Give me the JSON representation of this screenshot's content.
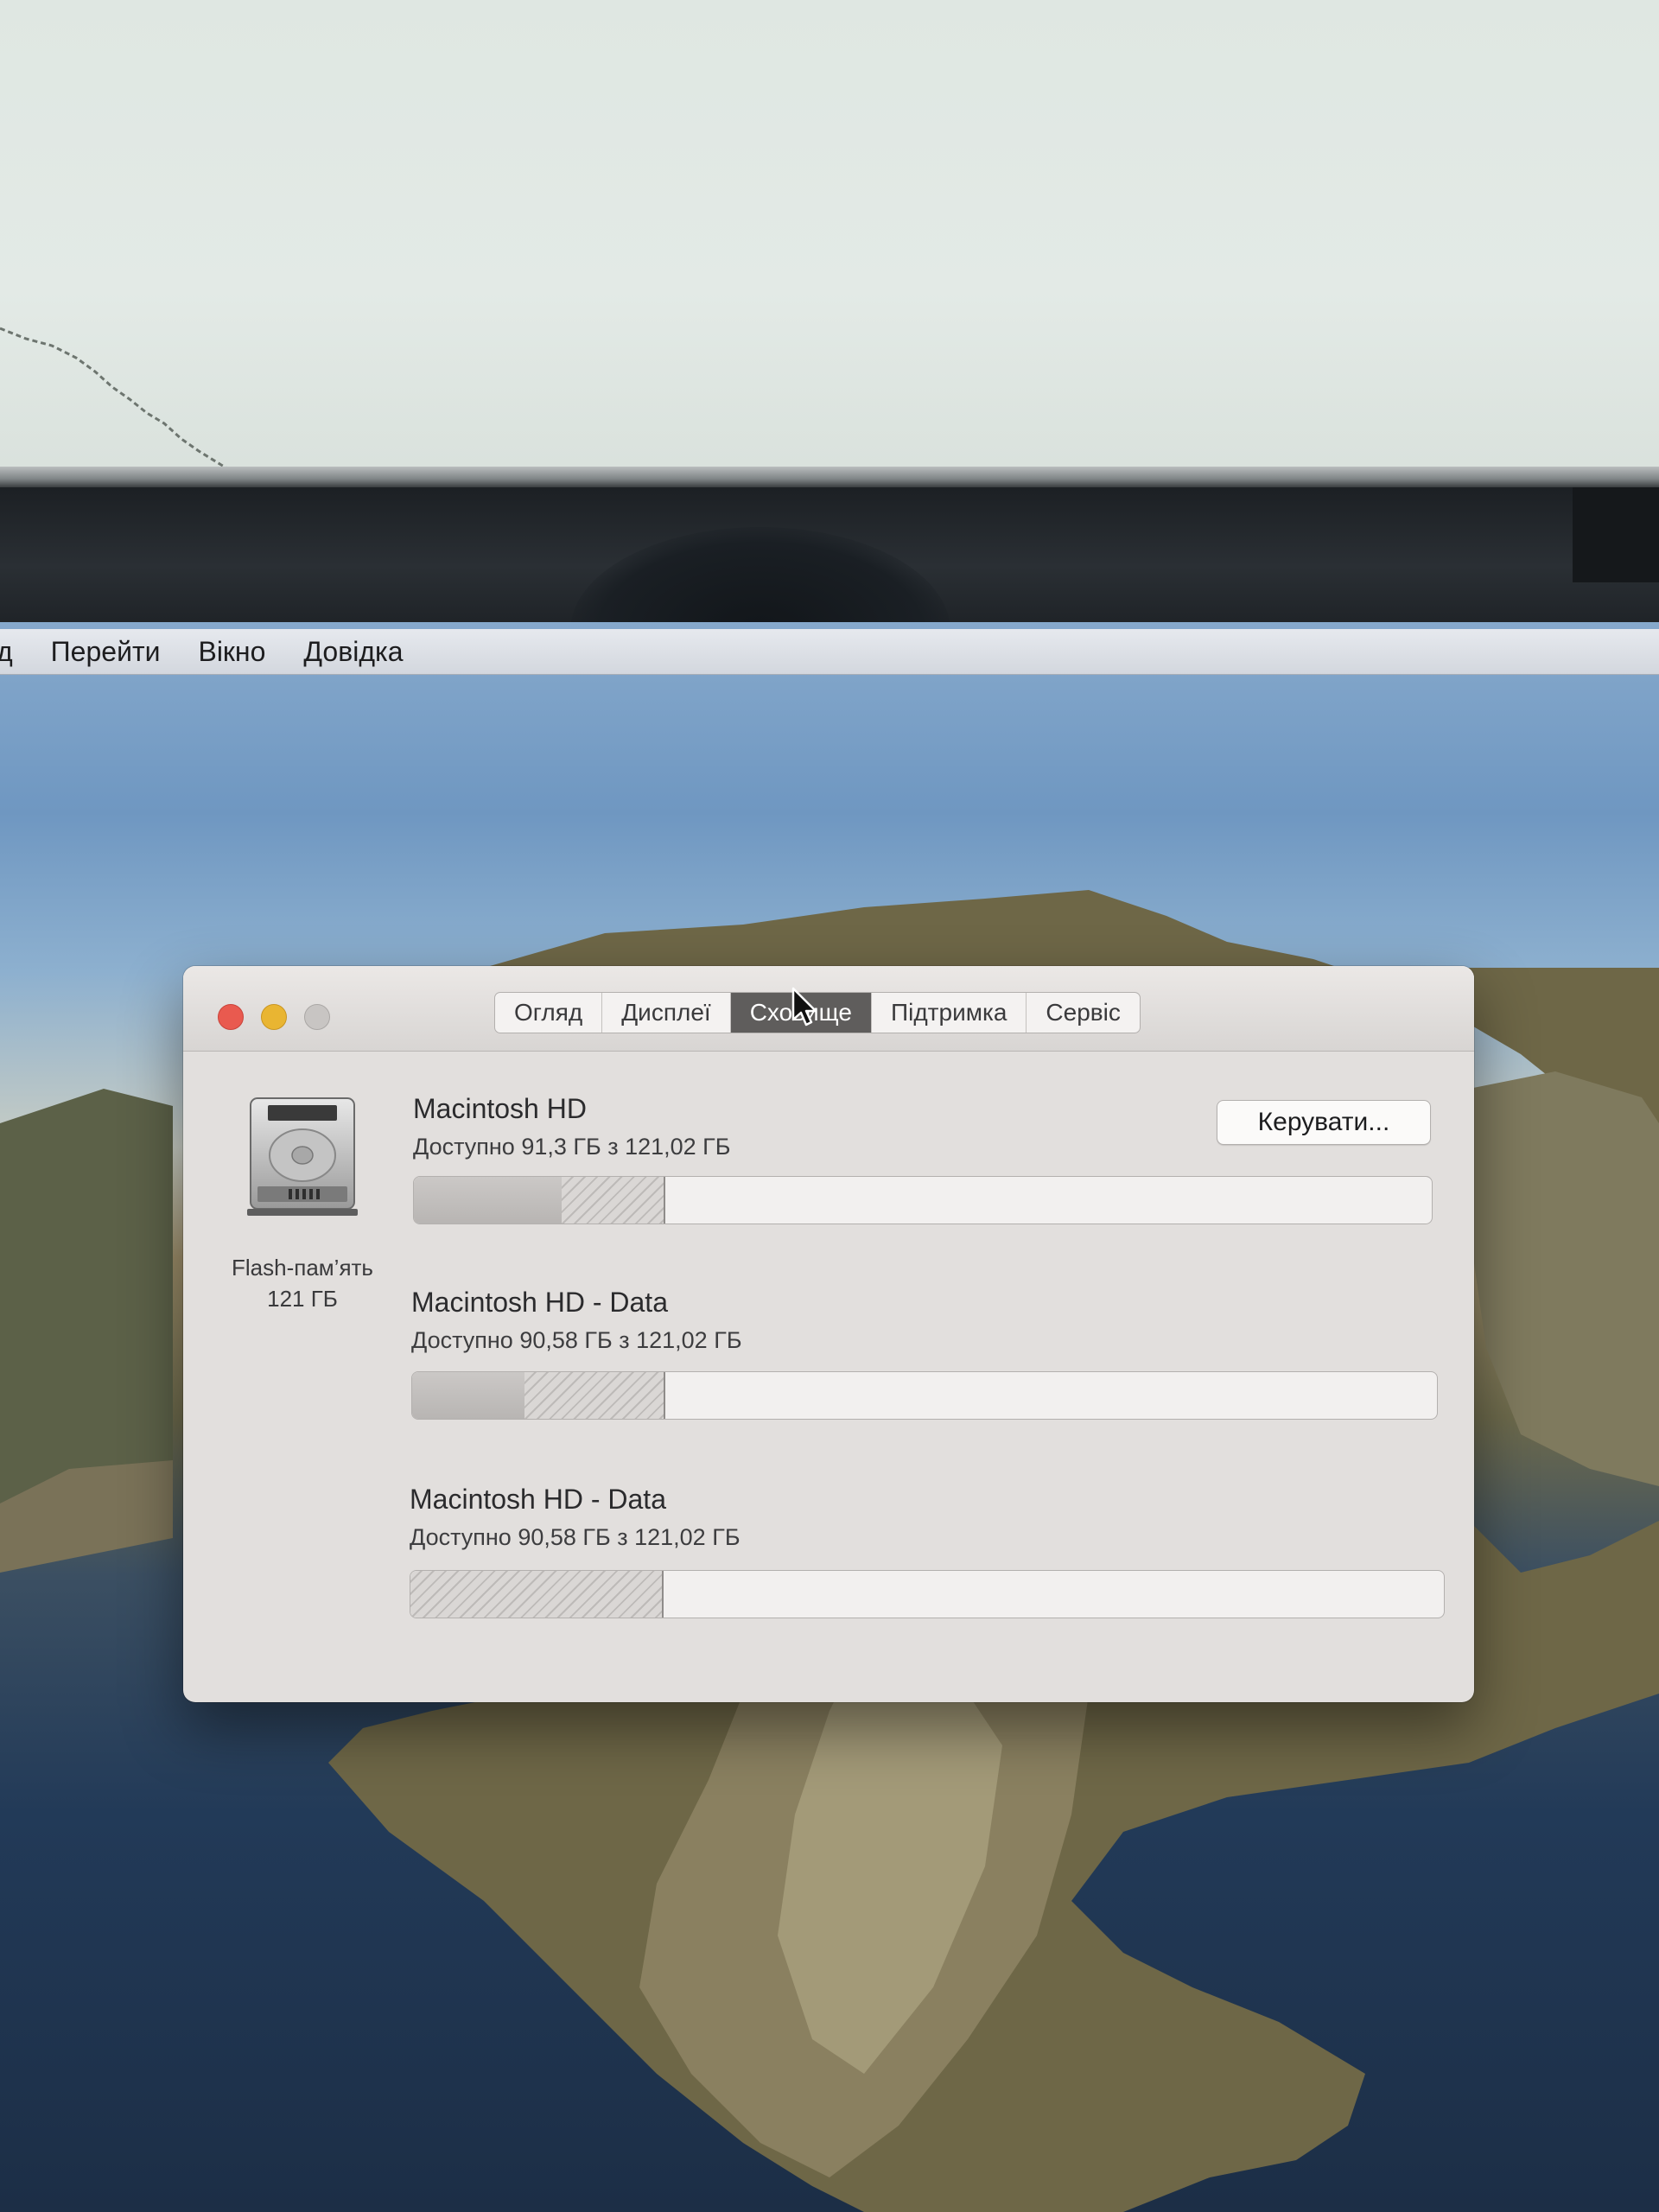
{
  "menubar": {
    "items": [
      "д",
      "Перейти",
      "Вікно",
      "Довідка"
    ]
  },
  "window": {
    "tabs": [
      {
        "label": "Огляд",
        "active": false
      },
      {
        "label": "Дисплеї",
        "active": false
      },
      {
        "label": "Сховище",
        "active": true
      },
      {
        "label": "Підтримка",
        "active": false
      },
      {
        "label": "Сервіс",
        "active": false
      }
    ],
    "drive": {
      "icon": "hard-drive-icon",
      "caption_line1": "Flash-пам’ять",
      "caption_line2": "121 ГБ"
    },
    "manage_button": "Керувати...",
    "volumes": [
      {
        "name": "Macintosh HD",
        "available": "Доступно 91,3 ГБ з 121,02 ГБ",
        "used_fraction": 0.145,
        "purgeable_fraction": 0.1
      },
      {
        "name": "Macintosh HD - Data",
        "available": "Доступно 90,58 ГБ з 121,02 ГБ",
        "used_fraction": 0.11,
        "purgeable_fraction": 0.135
      },
      {
        "name": "Macintosh HD - Data",
        "available": "Доступно 90,58 ГБ з 121,02 ГБ",
        "used_fraction": 0.0,
        "purgeable_fraction": 0.243
      }
    ]
  },
  "colors": {
    "close": "#e95a4f",
    "minimize": "#e9b532",
    "zoom_disabled": "#c8c5c3",
    "active_tab": "#5f5d5c"
  }
}
